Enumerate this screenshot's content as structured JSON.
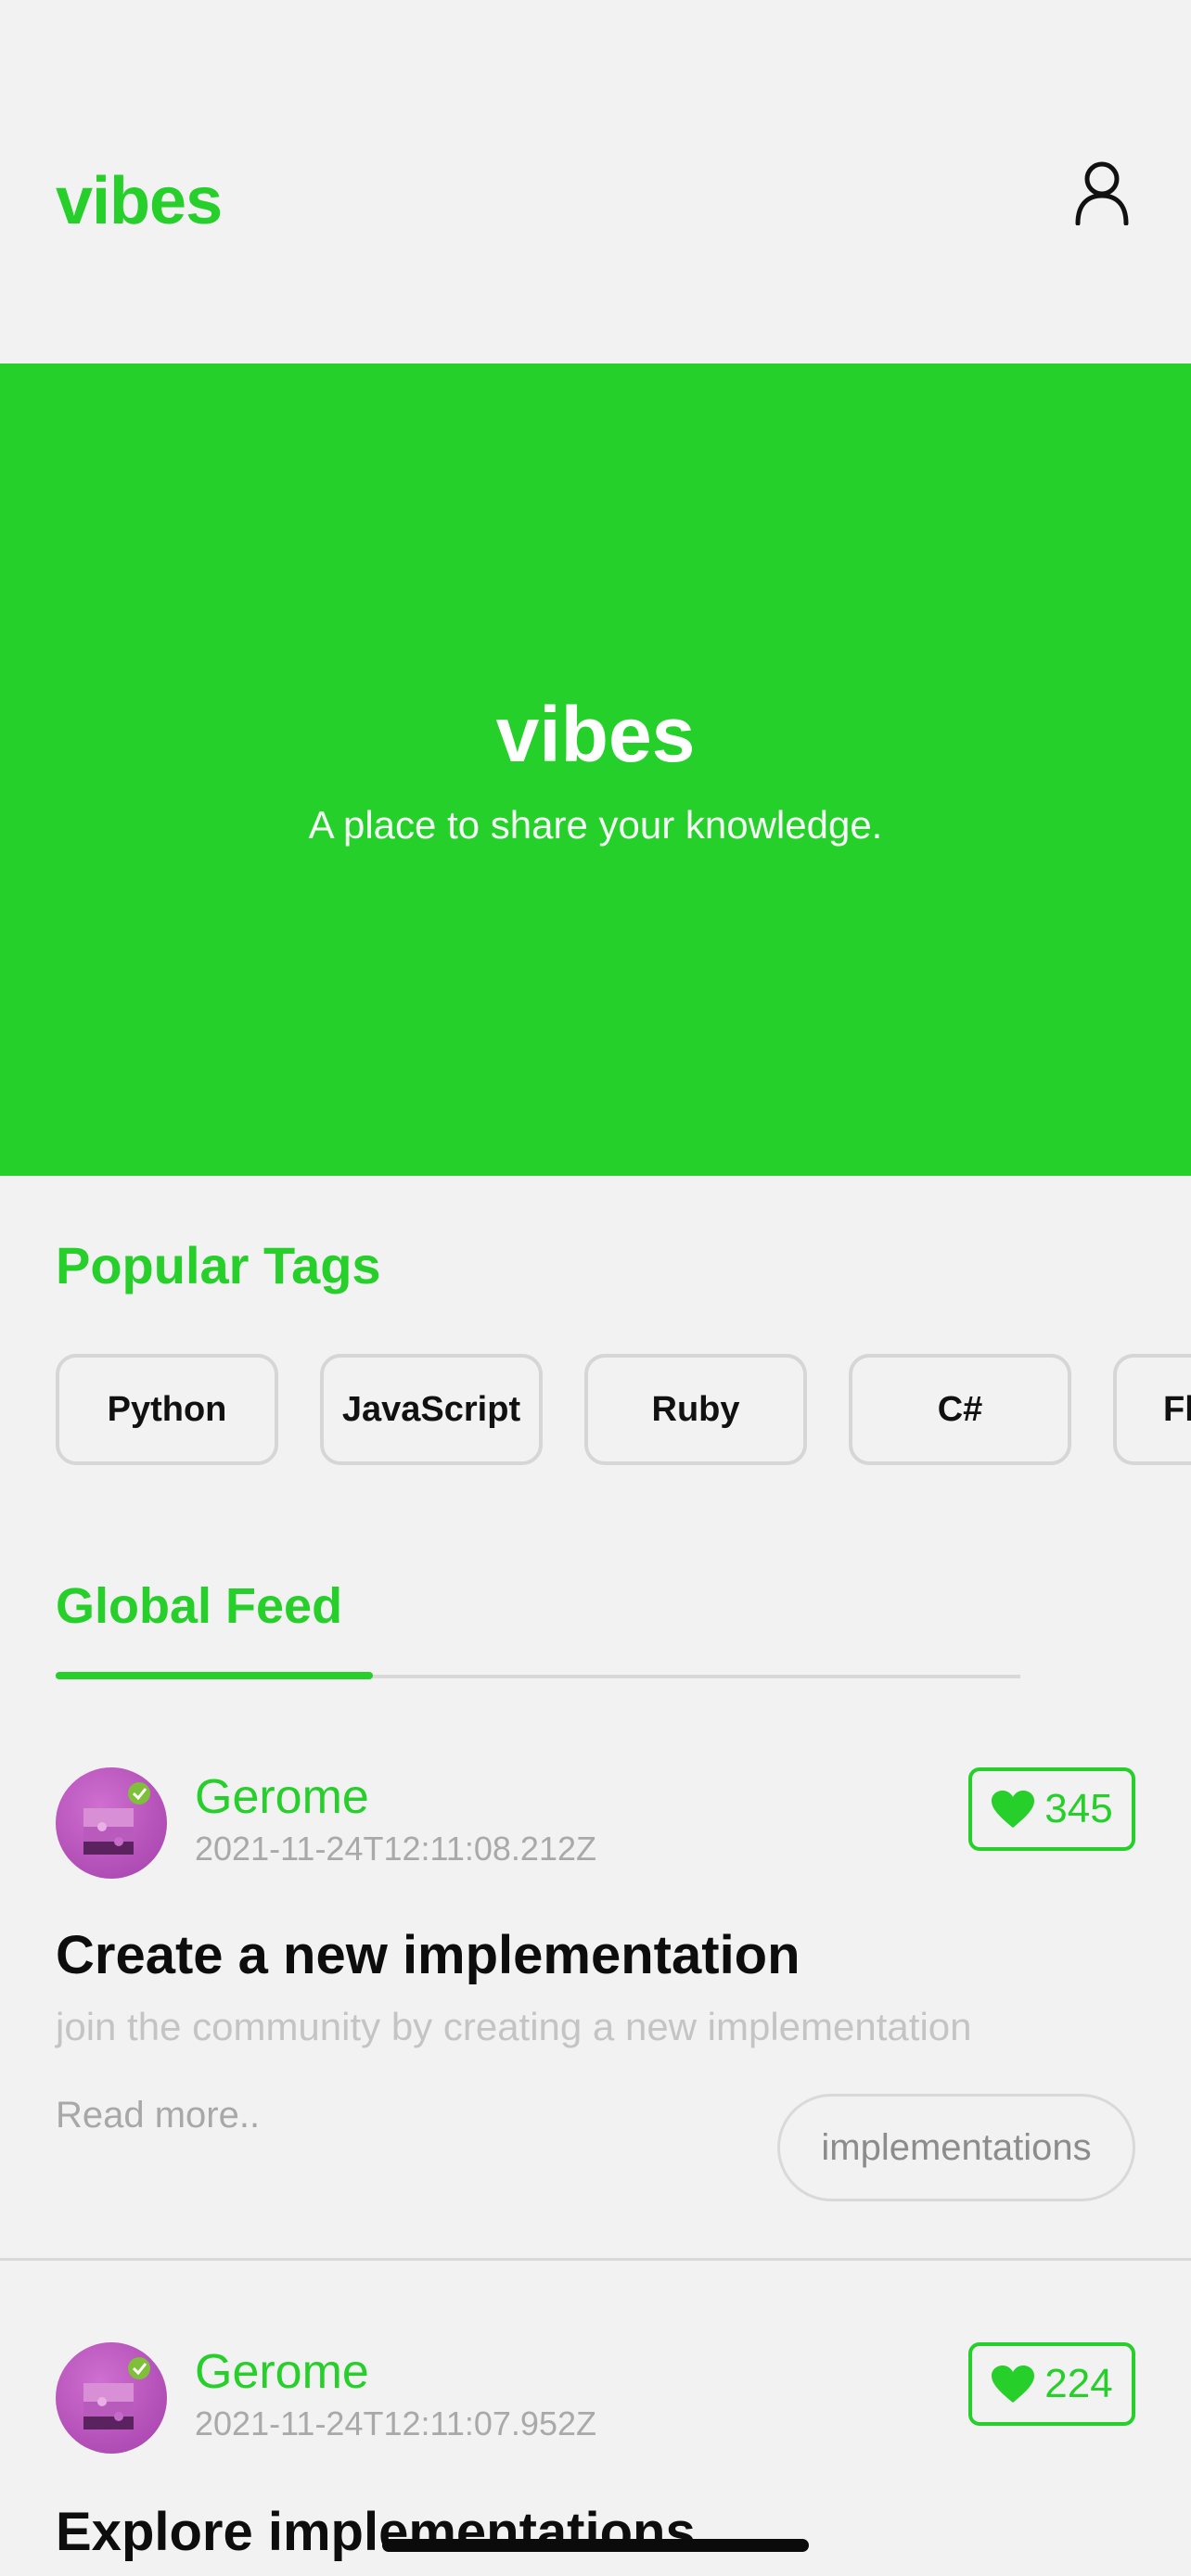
{
  "header": {
    "brand": "vibes",
    "profile_icon": "person-outline-icon"
  },
  "hero": {
    "title": "vibes",
    "subtitle": "A place to share your knowledge."
  },
  "popular_tags": {
    "title": "Popular Tags",
    "tags": [
      "Python",
      "JavaScript",
      "Ruby",
      "C#",
      "Fl"
    ]
  },
  "feed": {
    "tabs": [
      {
        "label": "Global Feed",
        "active": true
      }
    ],
    "articles": [
      {
        "author": "Gerome",
        "date": "2021-11-24T12:11:08.212Z",
        "likes": "345",
        "title": "Create a new implementation",
        "description": "join the community by creating a new implementation",
        "read_more": "Read more..",
        "tag": "implementations"
      },
      {
        "author": "Gerome",
        "date": "2021-11-24T12:11:07.952Z",
        "likes": "224",
        "title": "Explore implementations"
      }
    ]
  },
  "colors": {
    "accent": "#26cf2a",
    "background": "#f2f2f2",
    "muted_text": "#a9a9a9"
  }
}
